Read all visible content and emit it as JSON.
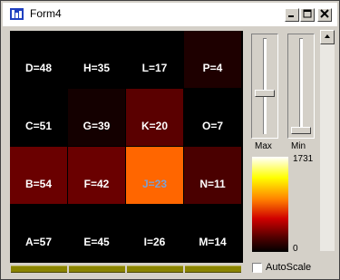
{
  "window": {
    "title": "Form4",
    "app_icon": "chart-app-icon",
    "minimize_icon": "minimize-icon",
    "maximize_icon": "maximize-icon",
    "close_icon": "close-icon"
  },
  "heatmap": {
    "columns": [
      [
        {
          "label": "A=57",
          "color": "#000000"
        },
        {
          "label": "B=54",
          "color": "#6a0000"
        },
        {
          "label": "C=51",
          "color": "#000000"
        },
        {
          "label": "D=48",
          "color": "#000000"
        }
      ],
      [
        {
          "label": "E=45",
          "color": "#000000"
        },
        {
          "label": "F=42",
          "color": "#6a0000"
        },
        {
          "label": "G=39",
          "color": "#140000"
        },
        {
          "label": "H=35",
          "color": "#000000"
        }
      ],
      [
        {
          "label": "I=26",
          "color": "#000000"
        },
        {
          "label": "J=23",
          "color": "#ff6600",
          "text_color": "#7fa0d0"
        },
        {
          "label": "K=20",
          "color": "#5a0000"
        },
        {
          "label": "L=17",
          "color": "#000000"
        }
      ],
      [
        {
          "label": "M=14",
          "color": "#000000"
        },
        {
          "label": "N=11",
          "color": "#4a0000"
        },
        {
          "label": "O=7",
          "color": "#000000"
        },
        {
          "label": "P=4",
          "color": "#1e0000"
        }
      ]
    ]
  },
  "sliders": {
    "max_label": "Max",
    "min_label": "Min"
  },
  "legend": {
    "max_value": "1731",
    "min_value": "0"
  },
  "autoscale": {
    "label": "AutoScale",
    "checked": false
  },
  "scrollbar": {
    "up_icon": "scroll-up-arrow-icon"
  }
}
